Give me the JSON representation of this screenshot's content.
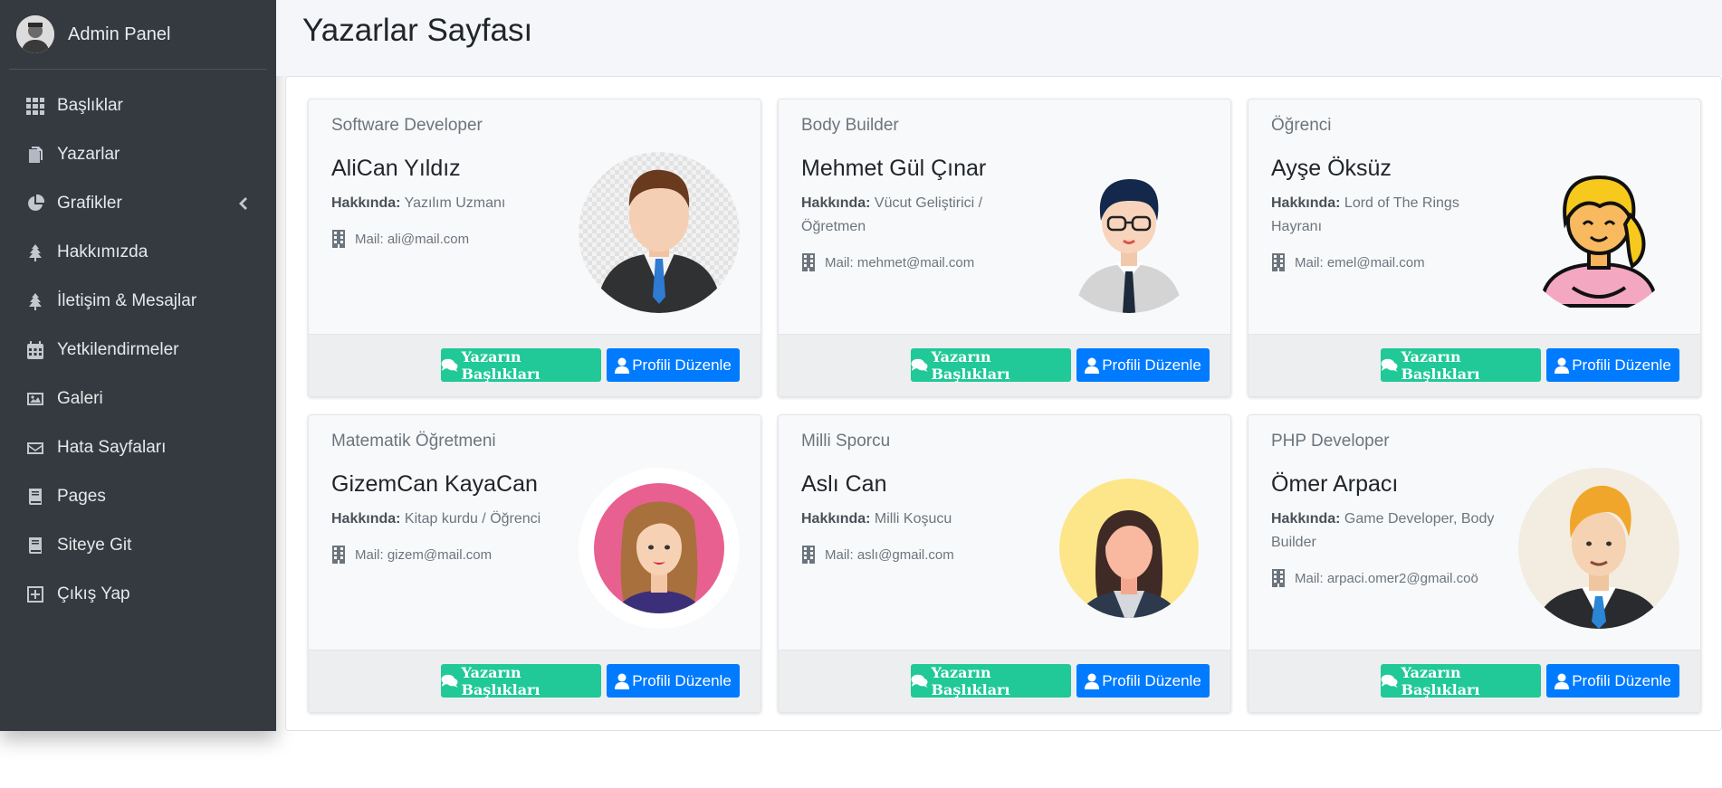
{
  "sidebar": {
    "brand": "Admin Panel",
    "items": [
      {
        "label": "Başlıklar",
        "icon": "th-grid-icon"
      },
      {
        "label": "Yazarlar",
        "icon": "copy-icon"
      },
      {
        "label": "Grafikler",
        "icon": "pie-chart-icon",
        "has_submenu": true
      },
      {
        "label": "Hakkımızda",
        "icon": "tree-icon"
      },
      {
        "label": "İletişim & Mesajlar",
        "icon": "tree-icon"
      },
      {
        "label": "Yetkilendirmeler",
        "icon": "calendar-icon"
      },
      {
        "label": "Galeri",
        "icon": "image-icon"
      },
      {
        "label": "Hata Sayfaları",
        "icon": "envelope-icon"
      },
      {
        "label": "Pages",
        "icon": "book-icon"
      },
      {
        "label": "Siteye Git",
        "icon": "book-icon"
      },
      {
        "label": "Çıkış Yap",
        "icon": "plus-square-icon"
      }
    ]
  },
  "header": {
    "title": "Yazarlar Sayfası"
  },
  "labels": {
    "about_prefix": "Hakkında:",
    "btn_titles": "Yazarın Başlıkları",
    "btn_edit": "Profili Düzenle"
  },
  "authors": [
    {
      "role": "Software Developer",
      "name": "AliCan Yıldız",
      "about": "Yazılım Uzmanı",
      "mail": "Mail: ali@mail.com",
      "avatar": "man-suit-avatar"
    },
    {
      "role": "Body Builder",
      "name": "Mehmet Gül Çınar",
      "about": "Vücut Geliştirici / Öğretmen",
      "mail": "Mail: mehmet@mail.com",
      "avatar": "man-glasses-avatar"
    },
    {
      "role": "Öğrenci",
      "name": "Ayşe Öksüz",
      "about": "Lord of The Rings Hayranı",
      "mail": "Mail: emel@mail.com",
      "avatar": "girl-blonde-avatar"
    },
    {
      "role": "Matematik Öğretmeni",
      "name": "GizemCan KayaCan",
      "about": "Kitap kurdu / Öğrenci",
      "mail": "Mail: gizem@mail.com",
      "avatar": "woman-pink-avatar"
    },
    {
      "role": "Milli Sporcu",
      "name": "Aslı Can",
      "about": "Milli Koşucu",
      "mail": "Mail: aslı@gmail.com",
      "avatar": "woman-yellow-avatar"
    },
    {
      "role": "PHP Developer",
      "name": "Ömer Arpacı",
      "about": "Game Developer, Body Builder",
      "mail": "Mail: arpaci.omer2@gmail.coö",
      "avatar": "man-blond-avatar"
    }
  ],
  "colors": {
    "sidebar_bg": "#343a40",
    "header_bg": "#f4f6f9",
    "btn_green": "#20c997",
    "btn_blue": "#007bff"
  }
}
